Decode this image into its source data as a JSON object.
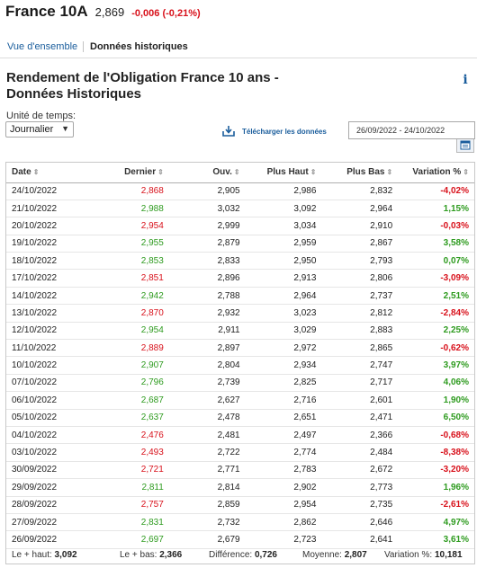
{
  "header": {
    "name": "France 10A",
    "price": "2,869",
    "change": "-0,006 (-0,21%)"
  },
  "tabs": {
    "overview": "Vue d'ensemble",
    "historical": "Données historiques"
  },
  "page_title": "Rendement de l'Obligation France 10 ans - Données Historiques",
  "controls": {
    "unit_label": "Unité de temps:",
    "unit_value": "Journalier",
    "download_label": "Télécharger les données",
    "date_range": "26/09/2022 - 24/10/2022"
  },
  "columns": [
    "Date",
    "Dernier",
    "Ouv.",
    "Plus Haut",
    "Plus Bas",
    "Variation %"
  ],
  "colors": {
    "negative": "#d8111b",
    "positive": "#2e9b1f",
    "link": "#1a5d9c"
  },
  "rows": [
    {
      "date": "24/10/2022",
      "last": "2,868",
      "open": "2,905",
      "high": "2,986",
      "low": "2,832",
      "change": "-4,02%",
      "dir": "down"
    },
    {
      "date": "21/10/2022",
      "last": "2,988",
      "open": "3,032",
      "high": "3,092",
      "low": "2,964",
      "change": "1,15%",
      "dir": "up"
    },
    {
      "date": "20/10/2022",
      "last": "2,954",
      "open": "2,999",
      "high": "3,034",
      "low": "2,910",
      "change": "-0,03%",
      "dir": "down"
    },
    {
      "date": "19/10/2022",
      "last": "2,955",
      "open": "2,879",
      "high": "2,959",
      "low": "2,867",
      "change": "3,58%",
      "dir": "up"
    },
    {
      "date": "18/10/2022",
      "last": "2,853",
      "open": "2,833",
      "high": "2,950",
      "low": "2,793",
      "change": "0,07%",
      "dir": "up"
    },
    {
      "date": "17/10/2022",
      "last": "2,851",
      "open": "2,896",
      "high": "2,913",
      "low": "2,806",
      "change": "-3,09%",
      "dir": "down"
    },
    {
      "date": "14/10/2022",
      "last": "2,942",
      "open": "2,788",
      "high": "2,964",
      "low": "2,737",
      "change": "2,51%",
      "dir": "up"
    },
    {
      "date": "13/10/2022",
      "last": "2,870",
      "open": "2,932",
      "high": "3,023",
      "low": "2,812",
      "change": "-2,84%",
      "dir": "down"
    },
    {
      "date": "12/10/2022",
      "last": "2,954",
      "open": "2,911",
      "high": "3,029",
      "low": "2,883",
      "change": "2,25%",
      "dir": "up"
    },
    {
      "date": "11/10/2022",
      "last": "2,889",
      "open": "2,897",
      "high": "2,972",
      "low": "2,865",
      "change": "-0,62%",
      "dir": "down"
    },
    {
      "date": "10/10/2022",
      "last": "2,907",
      "open": "2,804",
      "high": "2,934",
      "low": "2,747",
      "change": "3,97%",
      "dir": "up"
    },
    {
      "date": "07/10/2022",
      "last": "2,796",
      "open": "2,739",
      "high": "2,825",
      "low": "2,717",
      "change": "4,06%",
      "dir": "up"
    },
    {
      "date": "06/10/2022",
      "last": "2,687",
      "open": "2,627",
      "high": "2,716",
      "low": "2,601",
      "change": "1,90%",
      "dir": "up"
    },
    {
      "date": "05/10/2022",
      "last": "2,637",
      "open": "2,478",
      "high": "2,651",
      "low": "2,471",
      "change": "6,50%",
      "dir": "up"
    },
    {
      "date": "04/10/2022",
      "last": "2,476",
      "open": "2,481",
      "high": "2,497",
      "low": "2,366",
      "change": "-0,68%",
      "dir": "down"
    },
    {
      "date": "03/10/2022",
      "last": "2,493",
      "open": "2,722",
      "high": "2,774",
      "low": "2,484",
      "change": "-8,38%",
      "dir": "down"
    },
    {
      "date": "30/09/2022",
      "last": "2,721",
      "open": "2,771",
      "high": "2,783",
      "low": "2,672",
      "change": "-3,20%",
      "dir": "down"
    },
    {
      "date": "29/09/2022",
      "last": "2,811",
      "open": "2,814",
      "high": "2,902",
      "low": "2,773",
      "change": "1,96%",
      "dir": "up"
    },
    {
      "date": "28/09/2022",
      "last": "2,757",
      "open": "2,859",
      "high": "2,954",
      "low": "2,735",
      "change": "-2,61%",
      "dir": "down"
    },
    {
      "date": "27/09/2022",
      "last": "2,831",
      "open": "2,732",
      "high": "2,862",
      "low": "2,646",
      "change": "4,97%",
      "dir": "up"
    },
    {
      "date": "26/09/2022",
      "last": "2,697",
      "open": "2,679",
      "high": "2,723",
      "low": "2,641",
      "change": "3,61%",
      "dir": "up"
    }
  ],
  "summary": {
    "high_label": "Le + haut:",
    "high": "3,092",
    "low_label": "Le + bas:",
    "low": "2,366",
    "diff_label": "Différence:",
    "diff": "0,726",
    "avg_label": "Moyenne:",
    "avg": "2,807",
    "var_label": "Variation %:",
    "var": "10,181"
  }
}
